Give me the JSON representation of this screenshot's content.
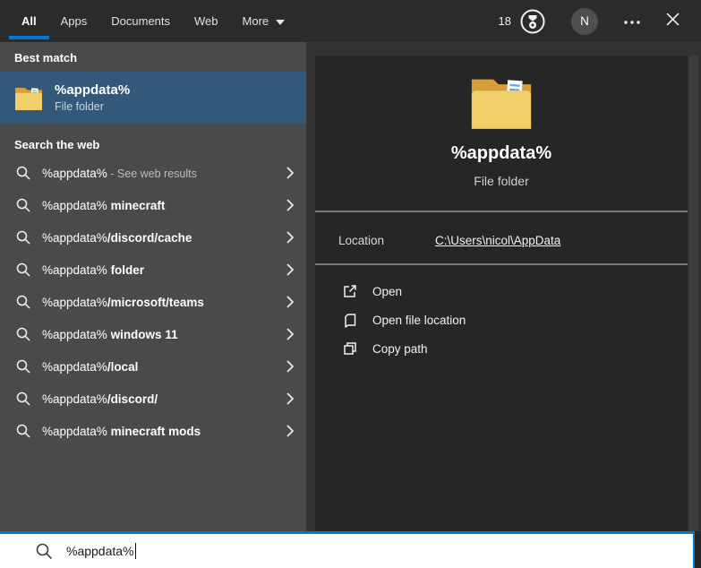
{
  "topbar": {
    "tabs": [
      {
        "label": "All"
      },
      {
        "label": "Apps"
      },
      {
        "label": "Documents"
      },
      {
        "label": "Web"
      },
      {
        "label": "More"
      }
    ],
    "rewards_count": "18",
    "avatar_initial": "N"
  },
  "left": {
    "best_match_header": "Best match",
    "best_match": {
      "title": "%appdata%",
      "subtitle": "File folder"
    },
    "search_web_header": "Search the web",
    "suggestions": [
      {
        "prefix": "%appdata%",
        "note": " - See web results"
      },
      {
        "prefix": "%appdata%",
        "bold": " minecraft"
      },
      {
        "prefix": "%appdata%",
        "bold": "/discord/cache"
      },
      {
        "prefix": "%appdata%",
        "bold": " folder"
      },
      {
        "prefix": "%appdata%",
        "bold": "/microsoft/teams"
      },
      {
        "prefix": "%appdata%",
        "bold": " windows 11"
      },
      {
        "prefix": "%appdata%",
        "bold": "/local"
      },
      {
        "prefix": "%appdata%",
        "bold": "/discord/"
      },
      {
        "prefix": "%appdata%",
        "bold": " minecraft mods"
      }
    ]
  },
  "preview": {
    "title": "%appdata%",
    "subtitle": "File folder",
    "location_label": "Location",
    "location_value": "C:\\Users\\nicol\\AppData",
    "actions": [
      {
        "label": "Open"
      },
      {
        "label": "Open file location"
      },
      {
        "label": "Copy path"
      }
    ]
  },
  "search": {
    "value": "%appdata%"
  },
  "colors": {
    "accent": "#0078d7",
    "highlight": "#33587a"
  }
}
